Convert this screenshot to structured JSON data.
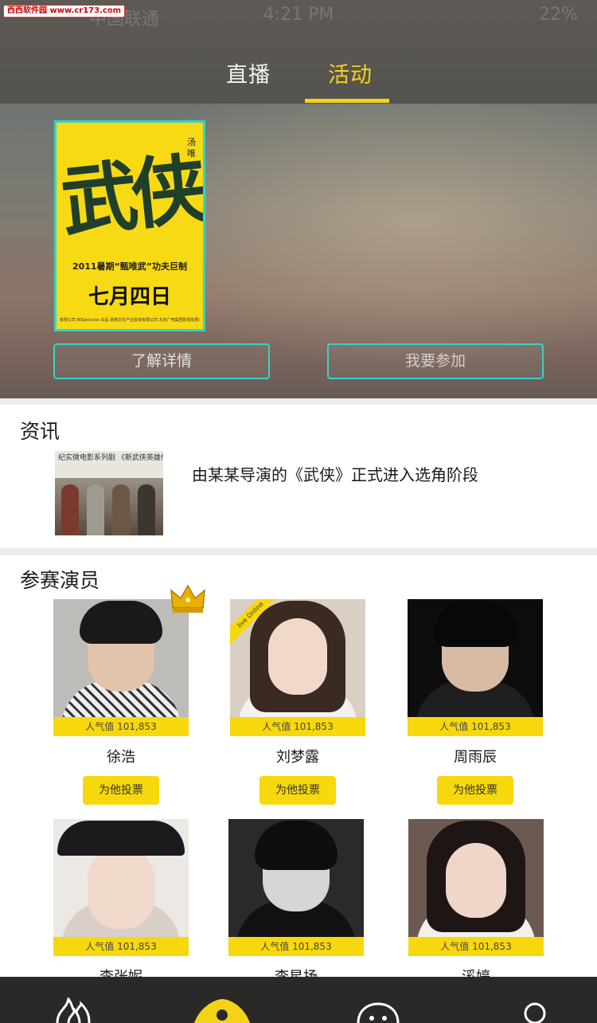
{
  "watermark": "西西软件园 www.cr173.com",
  "status": {
    "carrier": "中国联通",
    "time": "4:21 PM",
    "battery": "22%"
  },
  "tabs": [
    {
      "label": "直播"
    },
    {
      "label": "活动"
    }
  ],
  "poster": {
    "art": "武侠",
    "side": "汤唯",
    "tagline": "2011暑期“甄唯武”功夫巨制",
    "date": "七月四日",
    "credits": "有限公司  WSpictures  出品  承德文化产业投资有限公司  北京广电集团影视有限公司"
  },
  "hero_buttons": {
    "details": "了解详情",
    "join": "我要参加"
  },
  "news": {
    "heading": "资讯",
    "thumb_caption": "纪实微电影系列剧 《新武侠英雄传》新闻",
    "title": "由某某导演的《武侠》正式进入选角阶段"
  },
  "actors": {
    "heading": "参赛演员",
    "vote_label": "为他投票",
    "ribbon": "live Online",
    "list": [
      {
        "name": "徐浩",
        "popularity": "人气值  101,853"
      },
      {
        "name": "刘梦露",
        "popularity": "人气值  101,853"
      },
      {
        "name": "周雨辰",
        "popularity": "人气值  101,853"
      },
      {
        "name": "李张妮",
        "popularity": "人气值  101,853"
      },
      {
        "name": "李星扬",
        "popularity": "人气值  101,853"
      },
      {
        "name": "溪婷",
        "popularity": "人气值  101,853"
      }
    ]
  },
  "colors": {
    "accent": "#f5d21a",
    "teal_border": "#36d3c8",
    "nav_bg": "#2b2927"
  },
  "nav_icons": [
    "flame-icon",
    "home-icon",
    "face-icon",
    "user-icon"
  ]
}
